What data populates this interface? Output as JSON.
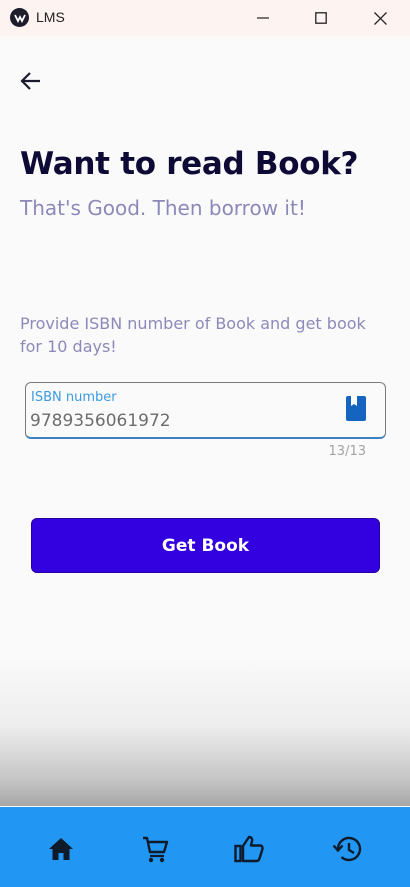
{
  "window": {
    "title": "LMS",
    "controls": [
      "minimize-icon",
      "maximize-icon",
      "close-icon"
    ]
  },
  "page": {
    "back_icon": "arrow-left-icon",
    "heading": "Want to read Book?",
    "subheading": "That's Good. Then borrow it!",
    "instructions": "Provide ISBN number of Book and get book for 10 days!"
  },
  "isbn_field": {
    "label": "ISBN number",
    "value": "9789356061972",
    "counter": "13/13",
    "icon": "book-icon"
  },
  "actions": {
    "get_book_label": "Get Book"
  },
  "bottom_nav": {
    "items": [
      {
        "icon": "home-icon"
      },
      {
        "icon": "cart-icon"
      },
      {
        "icon": "thumbs-up-icon"
      },
      {
        "icon": "history-icon"
      }
    ]
  },
  "colors": {
    "primary_button": "#3300e0",
    "bottom_nav": "#2196f3",
    "heading": "#0d0b36",
    "muted_text": "#8c89b8",
    "field_label": "#3b9ae1"
  }
}
